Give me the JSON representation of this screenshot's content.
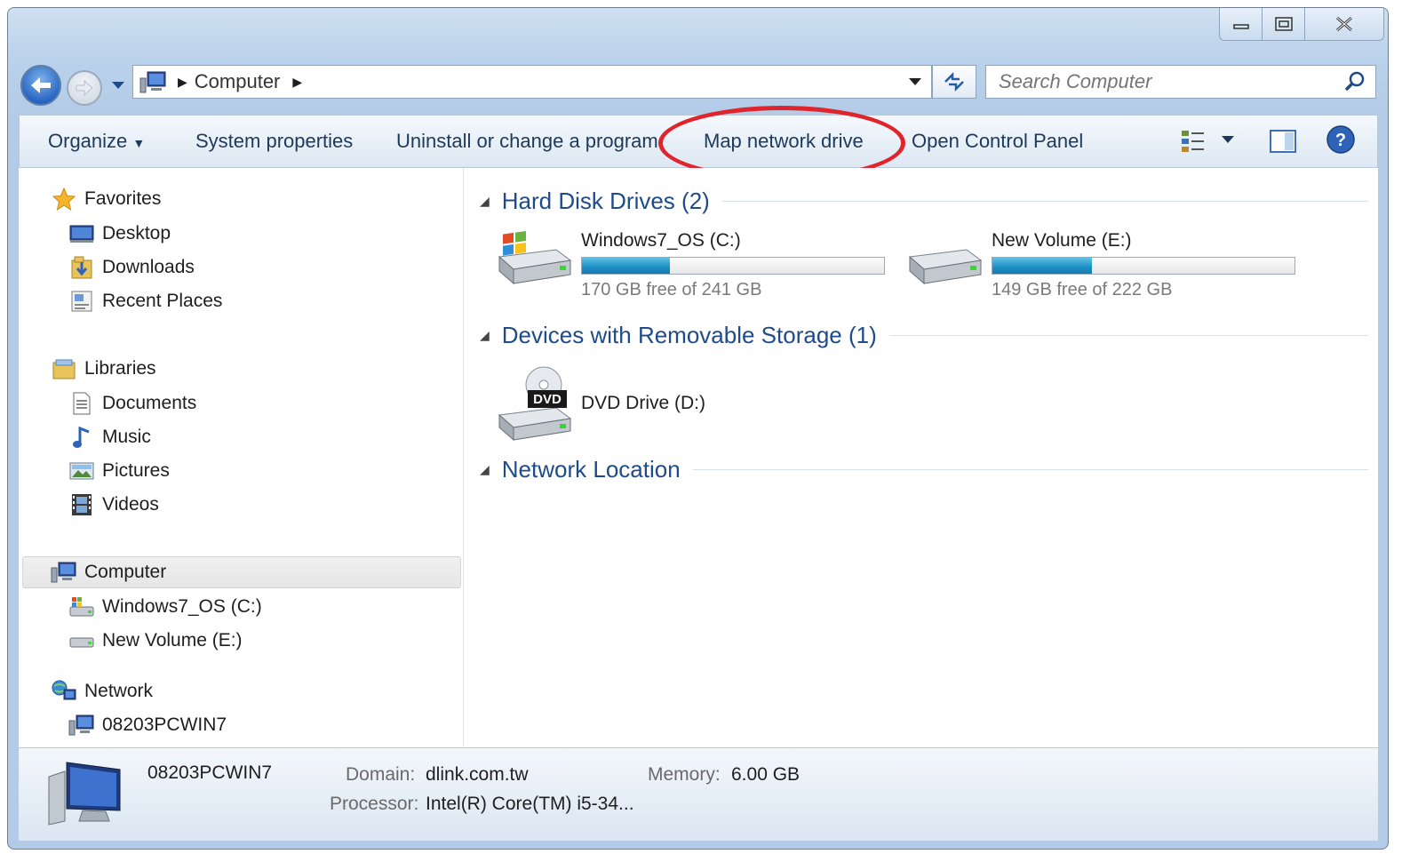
{
  "address": {
    "location": "Computer"
  },
  "search": {
    "placeholder": "Search Computer"
  },
  "toolbar": {
    "organize": "Organize",
    "system_properties": "System properties",
    "uninstall": "Uninstall or change a program",
    "map_network_drive": "Map network drive",
    "open_control_panel": "Open Control Panel"
  },
  "nav": {
    "favorites": {
      "label": "Favorites",
      "items": [
        "Desktop",
        "Downloads",
        "Recent Places"
      ]
    },
    "libraries": {
      "label": "Libraries",
      "items": [
        "Documents",
        "Music",
        "Pictures",
        "Videos"
      ]
    },
    "computer": {
      "label": "Computer",
      "items": [
        "Windows7_OS (C:)",
        "New Volume (E:)"
      ]
    },
    "network": {
      "label": "Network",
      "items": [
        "08203PCWIN7"
      ]
    }
  },
  "groups": {
    "hdd": "Hard Disk Drives (2)",
    "removable": "Devices with Removable Storage (1)",
    "network": "Network Location"
  },
  "drives": [
    {
      "name": "Windows7_OS (C:)",
      "free": "170 GB free of 241 GB",
      "used_fraction": 0.29
    },
    {
      "name": "New Volume (E:)",
      "free": "149 GB free of 222 GB",
      "used_fraction": 0.33
    }
  ],
  "dvd": {
    "name": "DVD Drive (D:)",
    "badge": "DVD"
  },
  "details": {
    "computer_name": "08203PCWIN7",
    "domain_label": "Domain:",
    "domain_value": "dlink.com.tw",
    "memory_label": "Memory:",
    "memory_value": "6.00 GB",
    "processor_label": "Processor:",
    "processor_value": "Intel(R) Core(TM) i5-34..."
  },
  "colors": {
    "annotation_ellipse": "#e0242b",
    "group_heading": "#1e4b8a",
    "bar_fill": "#1d8fc3"
  },
  "icons": [
    "back-arrow-icon",
    "forward-arrow-icon",
    "computer-icon",
    "refresh-icon",
    "search-icon",
    "star-icon",
    "library-icon",
    "network-icon",
    "drive-icon",
    "dvd-drive-icon",
    "help-icon"
  ]
}
